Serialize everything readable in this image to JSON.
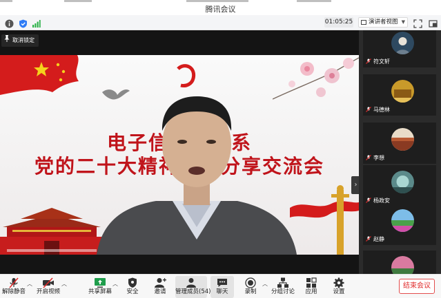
{
  "window": {
    "title": "腾讯会议"
  },
  "infobar": {
    "timer": "01:05:25",
    "view_mode": "演讲者视图"
  },
  "stage": {
    "unpin_label": "取消锁定",
    "slide": {
      "title_line1": "电子信息工程系",
      "title_line2": "党的二十大精神学习分享交流会"
    }
  },
  "participants": [
    {
      "name": "符文轩"
    },
    {
      "name": "马德林"
    },
    {
      "name": "李想"
    },
    {
      "name": "杨政安"
    },
    {
      "name": "赵静"
    }
  ],
  "toolbar": {
    "unmute": "解除静音",
    "start_video": "开启视频",
    "share_screen": "共享屏幕",
    "security": "安全",
    "invite": "邀请",
    "manage_members": "管理成员(54)",
    "chat": "聊天",
    "record": "录制",
    "breakout": "分组讨论",
    "apps": "应用",
    "settings": "设置",
    "end_meeting": "结束会议"
  },
  "colors": {
    "accent_red": "#e02b2b",
    "slide_red": "#c0141b",
    "stage_bg": "#141414",
    "gallery_bg": "#2b2b2b"
  }
}
